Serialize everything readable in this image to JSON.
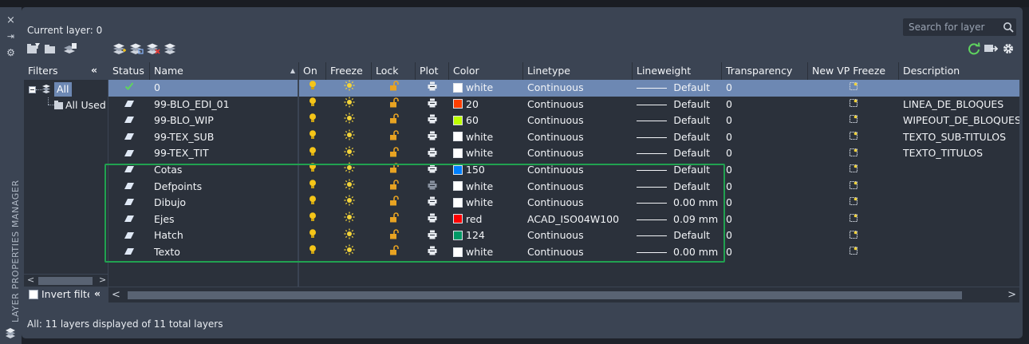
{
  "window": {
    "side_title": "LAYER PROPERTIES MANAGER",
    "close_glyph": "×",
    "autohide_glyph": "⇥",
    "properties_glyph": "⚙"
  },
  "header": {
    "current_layer": "Current layer: 0",
    "search_placeholder": "Search for layer"
  },
  "filters": {
    "header_label": "Filters",
    "collapse_glyph": "«",
    "tree": [
      {
        "label": "All",
        "selected": true
      },
      {
        "label": "All Used Layers",
        "selected": false
      }
    ],
    "scroll_left": "<",
    "scroll_right": ">",
    "invert_label": "Invert filter",
    "invert_checked": false,
    "invert_collapse_glyph": "«"
  },
  "columns": [
    "Status",
    "Name",
    "On",
    "Freeze",
    "Lock",
    "Plot",
    "Color",
    "Linetype",
    "Lineweight",
    "Transparency",
    "New VP Freeze",
    "Description"
  ],
  "sort_indicator": "▲",
  "layers": [
    {
      "status": "current",
      "name": "0",
      "color_name": "white",
      "color_hex": "#ffffff",
      "linetype": "Continuous",
      "lineweight": "Default",
      "transparency": "0",
      "description": "",
      "plot_enabled": true,
      "selected": true
    },
    {
      "status": "layer",
      "name": "99-BLO_EDI_01",
      "color_name": "20",
      "color_hex": "#ff3f00",
      "linetype": "Continuous",
      "lineweight": "Default",
      "transparency": "0",
      "description": "LINEA_DE_BLOQUES",
      "plot_enabled": true,
      "selected": false
    },
    {
      "status": "layer",
      "name": "99-BLO_WIP",
      "color_name": "60",
      "color_hex": "#bfff00",
      "linetype": "Continuous",
      "lineweight": "Default",
      "transparency": "0",
      "description": "WIPEOUT_DE_BLOQUES",
      "plot_enabled": true,
      "selected": false
    },
    {
      "status": "layer",
      "name": "99-TEX_SUB",
      "color_name": "white",
      "color_hex": "#ffffff",
      "linetype": "Continuous",
      "lineweight": "Default",
      "transparency": "0",
      "description": "TEXTO_SUB-TITULOS",
      "plot_enabled": true,
      "selected": false
    },
    {
      "status": "layer",
      "name": "99-TEX_TIT",
      "color_name": "white",
      "color_hex": "#ffffff",
      "linetype": "Continuous",
      "lineweight": "Default",
      "transparency": "0",
      "description": "TEXTO_TITULOS",
      "plot_enabled": true,
      "selected": false
    },
    {
      "status": "layer",
      "name": "Cotas",
      "color_name": "150",
      "color_hex": "#0080ff",
      "linetype": "Continuous",
      "lineweight": "Default",
      "transparency": "0",
      "description": "",
      "plot_enabled": true,
      "selected": false
    },
    {
      "status": "layer",
      "name": "Defpoints",
      "color_name": "white",
      "color_hex": "#ffffff",
      "linetype": "Continuous",
      "lineweight": "Default",
      "transparency": "0",
      "description": "",
      "plot_enabled": false,
      "selected": false
    },
    {
      "status": "layer",
      "name": "Dibujo",
      "color_name": "white",
      "color_hex": "#ffffff",
      "linetype": "Continuous",
      "lineweight": "0.00 mm",
      "transparency": "0",
      "description": "",
      "plot_enabled": true,
      "selected": false
    },
    {
      "status": "layer",
      "name": "Ejes",
      "color_name": "red",
      "color_hex": "#ff0000",
      "linetype": "ACAD_ISO04W100",
      "lineweight": "0.09 mm",
      "transparency": "0",
      "description": "",
      "plot_enabled": true,
      "selected": false
    },
    {
      "status": "layer",
      "name": "Hatch",
      "color_name": "124",
      "color_hex": "#009966",
      "linetype": "Continuous",
      "lineweight": "Default",
      "transparency": "0",
      "description": "",
      "plot_enabled": true,
      "selected": false
    },
    {
      "status": "layer",
      "name": "Texto",
      "color_name": "white",
      "color_hex": "#ffffff",
      "linetype": "Continuous",
      "lineweight": "0.00 mm",
      "transparency": "0",
      "description": "",
      "plot_enabled": true,
      "selected": false
    }
  ],
  "hscroll": {
    "left": "<",
    "right": ">"
  },
  "status_bar": "All: 11 layers displayed of 11 total layers",
  "colors": {
    "panel_bg": "#3b4453",
    "grid_bg": "#2b313b",
    "selection": "#6d88b3",
    "bulb_on": "#f5c518",
    "sun": "#f2d33a",
    "lock_open": "#e8a322",
    "check_green": "#5fd35f",
    "highlight_border": "#21a150"
  },
  "icons": {
    "on": "lightbulb-on-icon",
    "freeze": "sun-thawed-icon",
    "lock": "open-padlock-icon",
    "plot": "printer-icon",
    "vp_freeze": "viewport-freeze-icon",
    "status_current": "checkmark-icon",
    "status_layer": "layer-parallelogram-icon"
  }
}
